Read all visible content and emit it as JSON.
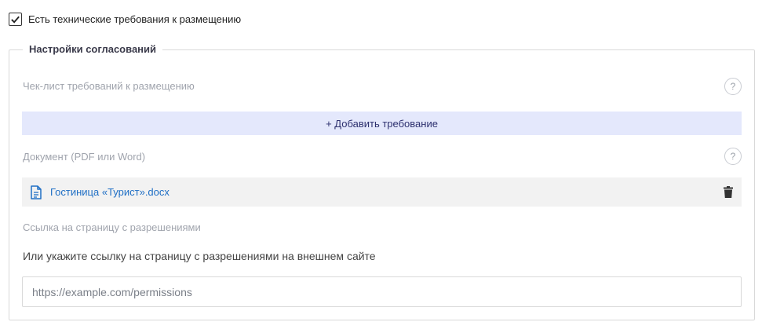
{
  "tech_requirements": {
    "checked": true,
    "label": "Есть технические требования к размещению"
  },
  "approval_settings": {
    "title": "Настройки согласований",
    "checklist": {
      "label": "Чек-лист требований к размещению",
      "help": "?",
      "add_button": "+ Добавить требование"
    },
    "document": {
      "label": "Документ (PDF или Word)",
      "help": "?",
      "file_name": "Гостиница «Турист».docx"
    },
    "permissions_link": {
      "label": "Ссылка на страницу с разрешениями",
      "hint": "Или укажите ссылку на страницу с разрешениями на внешнем сайте",
      "placeholder": "https://example.com/permissions",
      "value": ""
    }
  },
  "colors": {
    "accent_link": "#1f6fc5",
    "add_button_bg": "#e4e8fc",
    "doc_row_bg": "#f2f2f2"
  }
}
